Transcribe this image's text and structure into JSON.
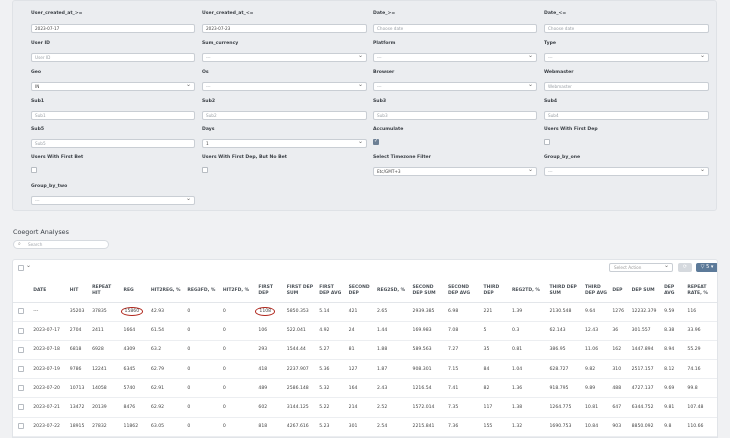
{
  "filters": {
    "user_created_from": {
      "label": "User_created_at_>=",
      "value": "2023-07-17"
    },
    "user_created_to": {
      "label": "User_created_at_<=",
      "value": "2023-07-23"
    },
    "date_from": {
      "label": "Date_>=",
      "placeholder": "Choose date"
    },
    "date_to": {
      "label": "Date_<=",
      "placeholder": "Choose date"
    },
    "user_id": {
      "label": "User ID",
      "placeholder": "User ID"
    },
    "sum_currency": {
      "label": "Sum_currency",
      "value": "---"
    },
    "platform": {
      "label": "Platform",
      "value": "---"
    },
    "type": {
      "label": "Type",
      "value": "---"
    },
    "geo": {
      "label": "Geo",
      "value": "IN"
    },
    "os": {
      "label": "Os",
      "value": "---"
    },
    "browser": {
      "label": "Browser",
      "value": "---"
    },
    "webmaster": {
      "label": "Webmaster",
      "placeholder": "Webmaster"
    },
    "sub1": {
      "label": "Sub1",
      "placeholder": "Sub1"
    },
    "sub2": {
      "label": "Sub2",
      "placeholder": "Sub2"
    },
    "sub3": {
      "label": "Sub3",
      "placeholder": "Sub3"
    },
    "sub4": {
      "label": "Sub4",
      "placeholder": "Sub4"
    },
    "sub5": {
      "label": "Sub5",
      "placeholder": "Sub5"
    },
    "days": {
      "label": "Days",
      "value": "1"
    },
    "accumulate": {
      "label": "Accumulate",
      "checked": true
    },
    "users_first_dep": {
      "label": "Users With First Dep",
      "checked": false
    },
    "users_first_bet": {
      "label": "Users With First Bet",
      "checked": false
    },
    "users_first_dep_no_bet": {
      "label": "Users With First Dep, But No Bet",
      "checked": false
    },
    "timezone": {
      "label": "Select Timezone Filter",
      "value": "Etc/GMT+3"
    },
    "group_by_one": {
      "label": "Group_by_one",
      "value": "---"
    },
    "group_by_two": {
      "label": "Group_by_two",
      "value": "---"
    }
  },
  "section": {
    "title": "Coegort Analyses",
    "search_placeholder": "Search"
  },
  "toolbar": {
    "action_placeholder": "Select Action",
    "grey_btn": "⟳",
    "blue_btn": "▽ 5 ▾"
  },
  "table": {
    "columns": [
      "DATE",
      "HIT",
      "REPEAT HIT",
      "REG",
      "HIT2REG, %",
      "REG3FD, %",
      "HIT2FD, %",
      "FIRST DEP",
      "FIRST DEP SUM",
      "FIRST DEP AVG",
      "SECOND DEP",
      "REG2SD, %",
      "SECOND DEP SUM",
      "SECOND DEP AVG",
      "THIRD DEP",
      "REG2TD, %",
      "THIRD DEP SUM",
      "THIRD DEP AVG",
      "DEP",
      "DEP SUM",
      "DEP AVG",
      "REPEAT RATE, %"
    ],
    "rows": [
      [
        "---",
        "35203",
        "37835",
        "15860",
        "42.93",
        "0",
        "0",
        "1108",
        "5850.353",
        "5.14",
        "421",
        "2.65",
        "2939.385",
        "6.98",
        "221",
        "1.39",
        "2130.548",
        "9.64",
        "1276",
        "12232.379",
        "9.59",
        "116"
      ],
      [
        "2023-07-17",
        "2704",
        "2411",
        "1664",
        "61.54",
        "0",
        "0",
        "106",
        "522.041",
        "4.92",
        "24",
        "1.44",
        "169.983",
        "7.08",
        "5",
        "0.3",
        "62.143",
        "12.43",
        "36",
        "301.557",
        "8.38",
        "33.96"
      ],
      [
        "2023-07-18",
        "6818",
        "6928",
        "4309",
        "63.2",
        "0",
        "0",
        "293",
        "1544.44",
        "5.27",
        "81",
        "1.88",
        "589.563",
        "7.27",
        "35",
        "0.81",
        "386.95",
        "11.06",
        "162",
        "1447.894",
        "8.94",
        "55.29"
      ],
      [
        "2023-07-19",
        "9786",
        "12241",
        "6345",
        "62.79",
        "0",
        "0",
        "418",
        "2237.907",
        "5.36",
        "127",
        "1.87",
        "908.301",
        "7.15",
        "84",
        "1.04",
        "628.727",
        "9.82",
        "310",
        "2517.157",
        "8.12",
        "74.16"
      ],
      [
        "2023-07-20",
        "10713",
        "14058",
        "5740",
        "62.91",
        "0",
        "0",
        "489",
        "2586.148",
        "5.32",
        "164",
        "2.43",
        "1216.54",
        "7.41",
        "82",
        "1.36",
        "918.795",
        "9.89",
        "488",
        "4727.137",
        "9.69",
        "99.8"
      ],
      [
        "2023-07-21",
        "13472",
        "20139",
        "8476",
        "62.92",
        "0",
        "0",
        "602",
        "3144.125",
        "5.22",
        "214",
        "2.52",
        "1572.014",
        "7.35",
        "117",
        "1.38",
        "1264.775",
        "10.81",
        "647",
        "6344.752",
        "9.81",
        "107.48"
      ],
      [
        "2023-07-22",
        "18915",
        "27832",
        "11862",
        "63.05",
        "0",
        "0",
        "818",
        "4267.616",
        "5.23",
        "301",
        "2.54",
        "2215.841",
        "7.36",
        "155",
        "1.32",
        "1690.753",
        "10.84",
        "903",
        "8850.092",
        "9.8",
        "110.66"
      ]
    ]
  },
  "highlight_color": "#b0261c"
}
